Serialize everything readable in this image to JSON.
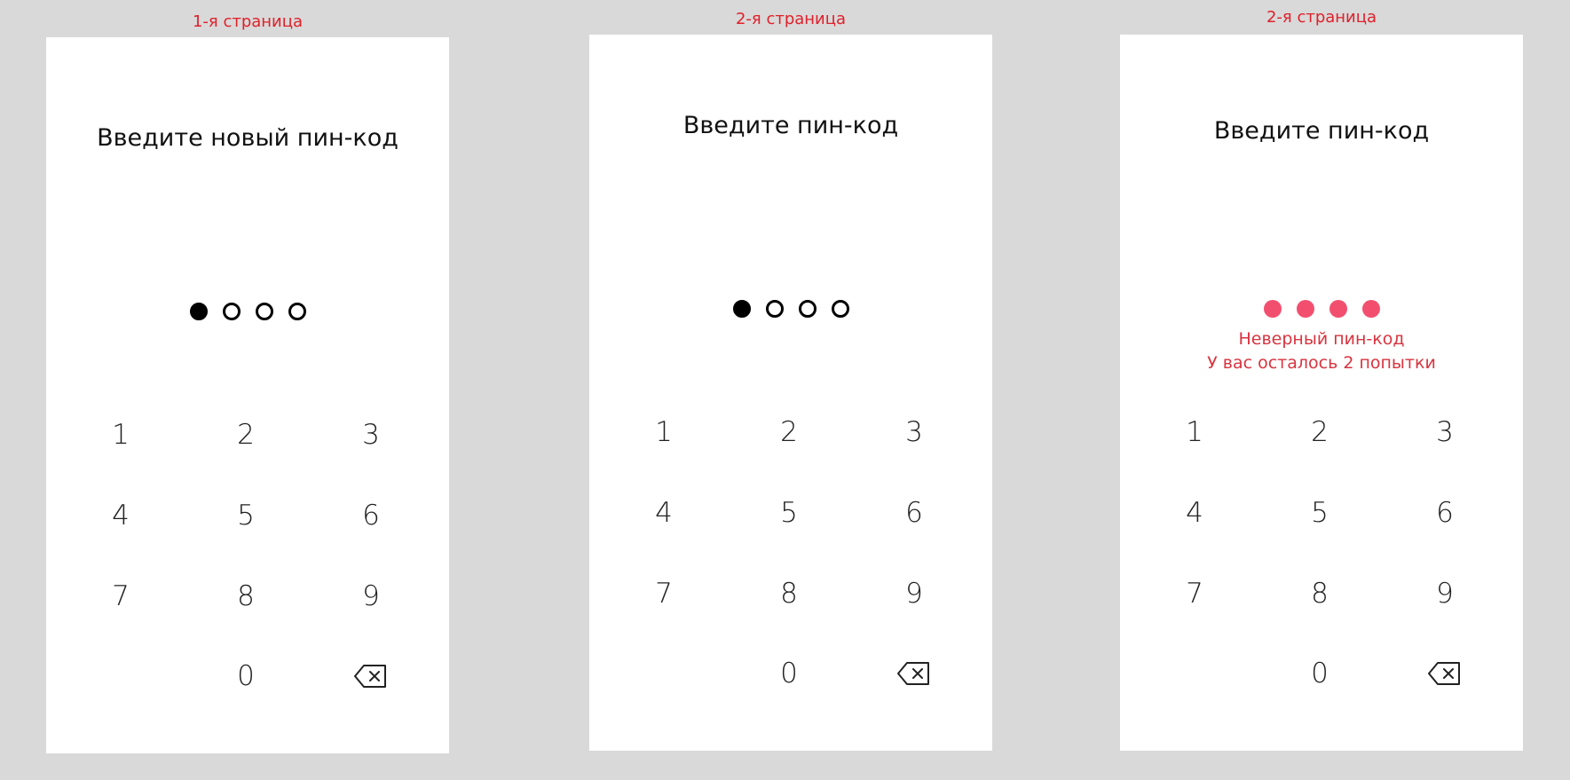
{
  "screens": [
    {
      "caption": "1-я страница",
      "title": "Введите новый пин-код",
      "dots": [
        "filled",
        "empty",
        "empty",
        "empty"
      ],
      "error": null
    },
    {
      "caption": "2-я страница",
      "title": "Введите пин-код",
      "dots": [
        "filled",
        "empty",
        "empty",
        "empty"
      ],
      "error": null
    },
    {
      "caption": "2-я страница",
      "title": "Введите пин-код",
      "dots": [
        "error",
        "error",
        "error",
        "error"
      ],
      "error": {
        "line1": "Неверный пин-код",
        "line2": "У вас осталось 2 попытки"
      }
    }
  ],
  "keypad": {
    "keys": [
      "1",
      "2",
      "3",
      "4",
      "5",
      "6",
      "7",
      "8",
      "9",
      "0"
    ],
    "backspace_icon": "backspace-icon"
  },
  "colors": {
    "background": "#d9d9d9",
    "screen": "#ffffff",
    "caption": "#e0202a",
    "error_dot": "#f24f6f",
    "error_text": "#d8343f"
  }
}
